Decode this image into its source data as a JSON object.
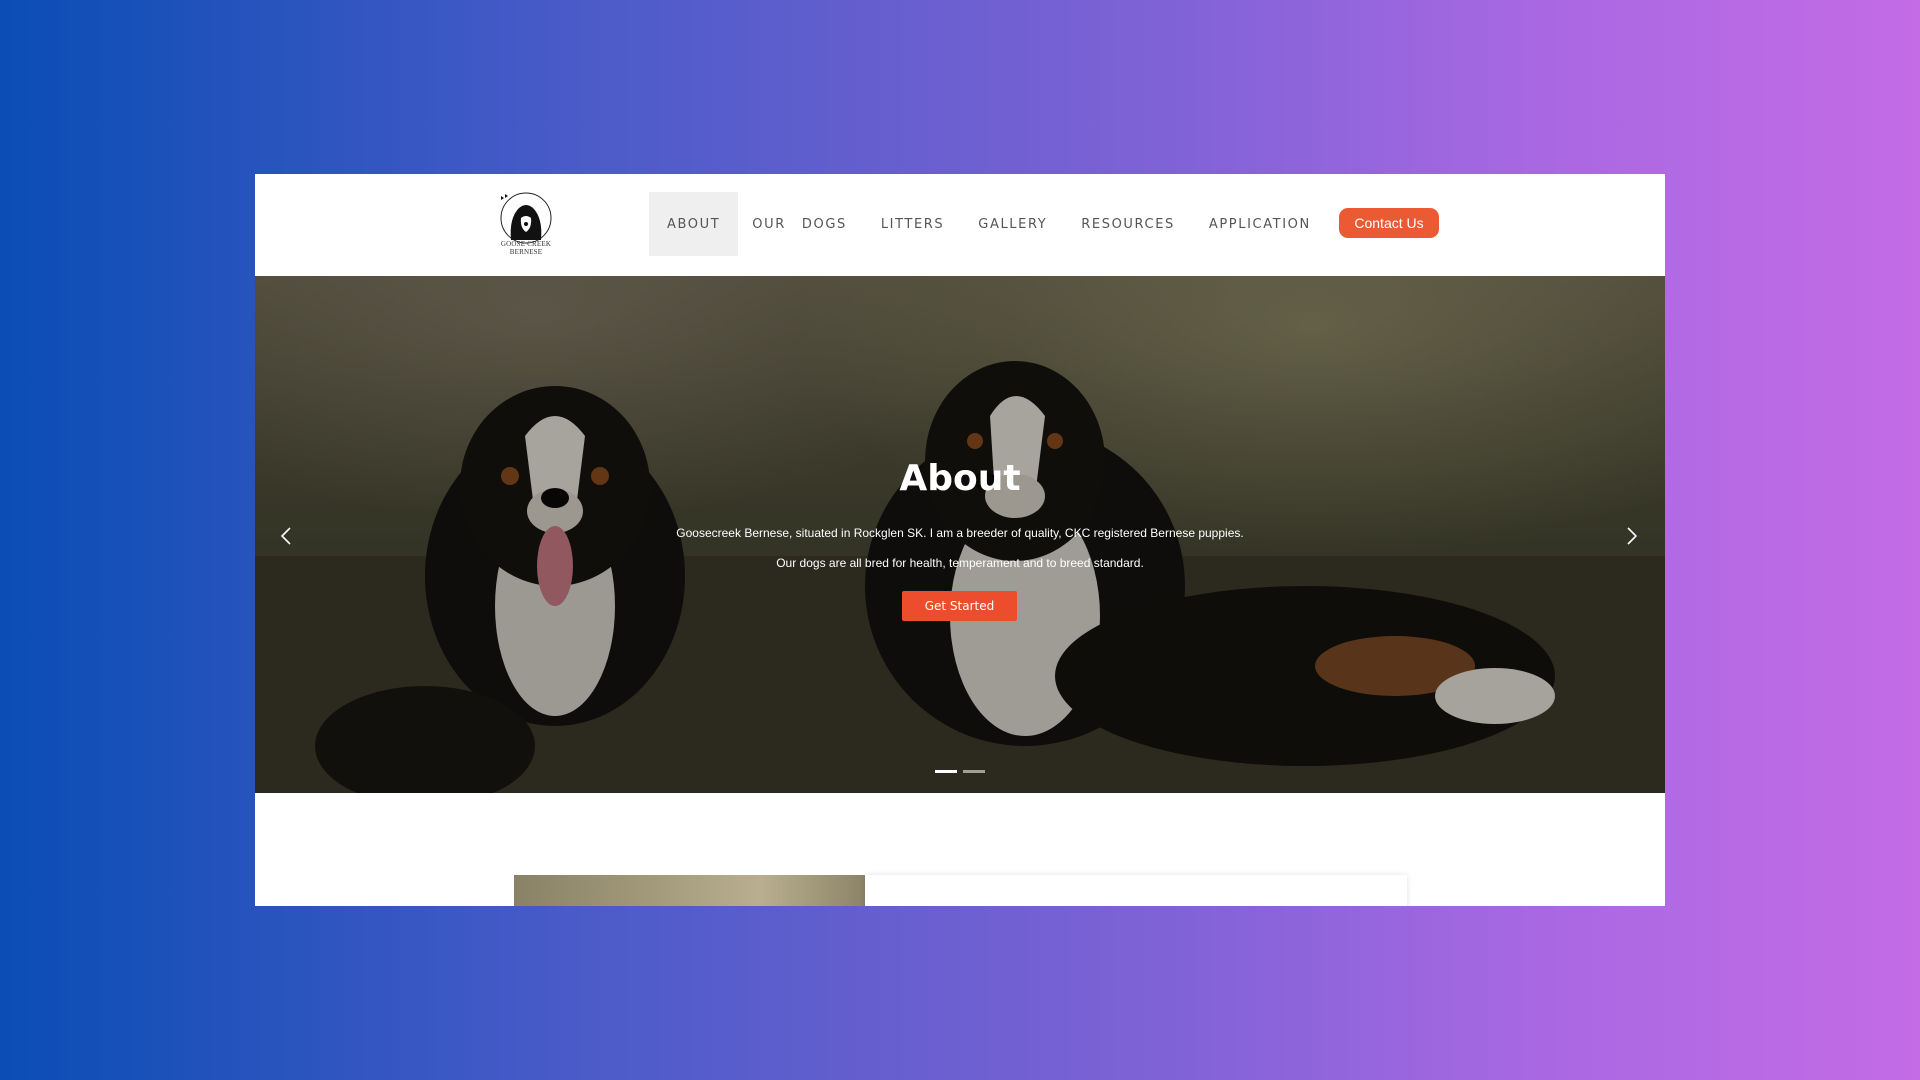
{
  "brand": {
    "logo_text": "GOOSE CREEK BERNESE"
  },
  "nav": {
    "items": [
      {
        "label": "ABOUT",
        "active": true
      },
      {
        "label": "OUR"
      },
      {
        "label": "DOGS"
      },
      {
        "label": "LITTERS"
      },
      {
        "label": "GALLERY"
      },
      {
        "label": "RESOURCES"
      },
      {
        "label": "APPLICATION"
      }
    ],
    "contact_label": "Contact Us"
  },
  "hero": {
    "title": "About",
    "line1": "Goosecreek Bernese, situated in Rockglen SK. I am a breeder of quality, CKC registered Bernese puppies.",
    "line2": "Our dogs are all bred for health, temperament and to breed standard.",
    "cta_label": "Get Started",
    "slides_total": 2,
    "slide_active": 1,
    "prev_icon": "chevron-left-icon",
    "next_icon": "chevron-right-icon"
  },
  "colors": {
    "accent": "#ec5a34",
    "cta": "#ec4d2c",
    "nav_active_bg": "#efefef",
    "nav_text": "#555555"
  }
}
